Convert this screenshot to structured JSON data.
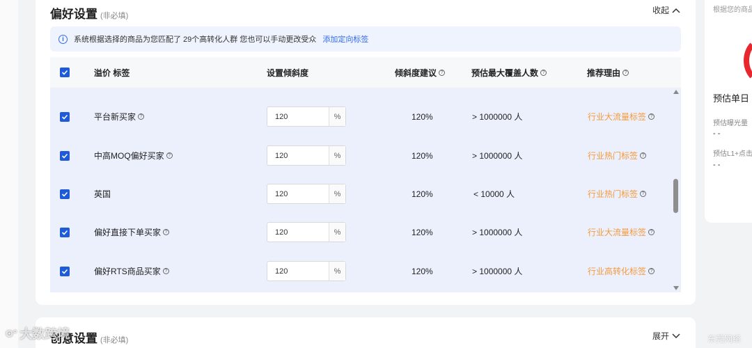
{
  "preference": {
    "title": "偏好设置",
    "subtitle": "(非必填)",
    "collapse_label": "收起"
  },
  "notice": {
    "text": "系统根据选择的商品为您匹配了 29个高转化人群 您也可以手动更改受众",
    "link": "添加定向标签"
  },
  "table": {
    "headers": {
      "tag": "溢价 标签",
      "slope": "设置倾斜度",
      "suggest": "倾斜度建议",
      "coverage": "预估最大覆盖人数",
      "reason": "推荐理由"
    },
    "rows": [
      {
        "name": "平台新买家",
        "has_help": true,
        "slope": "120",
        "suggest": "120%",
        "coverage": "> 1000000 人",
        "reason": "行业大流量标签"
      },
      {
        "name": "中高MOQ偏好买家",
        "has_help": true,
        "slope": "120",
        "suggest": "120%",
        "coverage": "> 1000000 人",
        "reason": "行业热门标签"
      },
      {
        "name": "英国",
        "has_help": false,
        "slope": "120",
        "suggest": "120%",
        "coverage": "< 10000 人",
        "reason": "行业热门标签"
      },
      {
        "name": "偏好直接下单买家",
        "has_help": true,
        "slope": "120",
        "suggest": "120%",
        "coverage": "> 1000000 人",
        "reason": "行业大流量标签"
      },
      {
        "name": "偏好RTS商品买家",
        "has_help": true,
        "slope": "120",
        "suggest": "120%",
        "coverage": "> 1000000 人",
        "reason": "行业高转化标签"
      }
    ],
    "unit": "%"
  },
  "creative": {
    "title": "创意设置",
    "subtitle": "(非必填)",
    "expand_label": "展开"
  },
  "side_panel": {
    "hint": "根据您的商品",
    "estimate_title": "预估单日",
    "exposure_label": "预估曝光量",
    "exposure_value": "- -",
    "click_label": "预估L1+点击",
    "click_value": "- -"
  },
  "watermarks": {
    "left": "大数跨境",
    "right": "东莞网络"
  },
  "colors": {
    "accent": "#2e6bf0",
    "checkbox": "#1f5bd8",
    "reason": "#f59a3c",
    "row_bg": "#ebf0fc"
  }
}
